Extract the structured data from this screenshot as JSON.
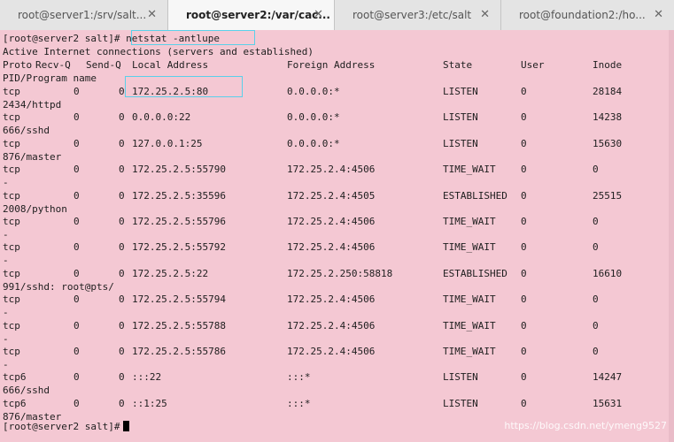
{
  "tabs": [
    {
      "label": "root@server1:/srv/salt..."
    },
    {
      "label": "root@server2:/var/cac..."
    },
    {
      "label": "root@server3:/etc/salt"
    },
    {
      "label": "root@foundation2:/ho..."
    }
  ],
  "close_glyph": "✕",
  "terminal": {
    "prompt": "[root@server2 salt]# ",
    "command": "netstat -antlupe",
    "header1": "Active Internet connections (servers and established)",
    "columns": [
      "Proto",
      "Recv-Q",
      "Send-Q",
      "Local Address",
      "Foreign Address",
      "State",
      "User",
      "Inode"
    ],
    "pid_header": "PID/Program name",
    "rows": [
      {
        "proto": "tcp",
        "recvq": "0",
        "sendq": "0",
        "local": "172.25.2.5:80",
        "foreign": "0.0.0.0:*",
        "state": "LISTEN",
        "user": "0",
        "inode": "28184",
        "pid": "2434/httpd"
      },
      {
        "proto": "tcp",
        "recvq": "0",
        "sendq": "0",
        "local": "0.0.0.0:22",
        "foreign": "0.0.0.0:*",
        "state": "LISTEN",
        "user": "0",
        "inode": "14238",
        "pid": "666/sshd"
      },
      {
        "proto": "tcp",
        "recvq": "0",
        "sendq": "0",
        "local": "127.0.0.1:25",
        "foreign": "0.0.0.0:*",
        "state": "LISTEN",
        "user": "0",
        "inode": "15630",
        "pid": "876/master"
      },
      {
        "proto": "tcp",
        "recvq": "0",
        "sendq": "0",
        "local": "172.25.2.5:55790",
        "foreign": "172.25.2.4:4506",
        "state": "TIME_WAIT",
        "user": "0",
        "inode": "0",
        "pid": "-"
      },
      {
        "proto": "tcp",
        "recvq": "0",
        "sendq": "0",
        "local": "172.25.2.5:35596",
        "foreign": "172.25.2.4:4505",
        "state": "ESTABLISHED",
        "user": "0",
        "inode": "25515",
        "pid": "2008/python"
      },
      {
        "proto": "tcp",
        "recvq": "0",
        "sendq": "0",
        "local": "172.25.2.5:55796",
        "foreign": "172.25.2.4:4506",
        "state": "TIME_WAIT",
        "user": "0",
        "inode": "0",
        "pid": "-"
      },
      {
        "proto": "tcp",
        "recvq": "0",
        "sendq": "0",
        "local": "172.25.2.5:55792",
        "foreign": "172.25.2.4:4506",
        "state": "TIME_WAIT",
        "user": "0",
        "inode": "0",
        "pid": "-"
      },
      {
        "proto": "tcp",
        "recvq": "0",
        "sendq": "0",
        "local": "172.25.2.5:22",
        "foreign": "172.25.2.250:58818",
        "state": "ESTABLISHED",
        "user": "0",
        "inode": "16610",
        "pid": "991/sshd: root@pts/"
      },
      {
        "proto": "tcp",
        "recvq": "0",
        "sendq": "0",
        "local": "172.25.2.5:55794",
        "foreign": "172.25.2.4:4506",
        "state": "TIME_WAIT",
        "user": "0",
        "inode": "0",
        "pid": "-"
      },
      {
        "proto": "tcp",
        "recvq": "0",
        "sendq": "0",
        "local": "172.25.2.5:55788",
        "foreign": "172.25.2.4:4506",
        "state": "TIME_WAIT",
        "user": "0",
        "inode": "0",
        "pid": "-"
      },
      {
        "proto": "tcp",
        "recvq": "0",
        "sendq": "0",
        "local": "172.25.2.5:55786",
        "foreign": "172.25.2.4:4506",
        "state": "TIME_WAIT",
        "user": "0",
        "inode": "0",
        "pid": "-"
      },
      {
        "proto": "tcp6",
        "recvq": "0",
        "sendq": "0",
        "local": ":::22",
        "foreign": ":::*",
        "state": "LISTEN",
        "user": "0",
        "inode": "14247",
        "pid": "666/sshd"
      },
      {
        "proto": "tcp6",
        "recvq": "0",
        "sendq": "0",
        "local": "::1:25",
        "foreign": ":::*",
        "state": "LISTEN",
        "user": "0",
        "inode": "15631",
        "pid": "876/master"
      }
    ],
    "final_prompt": "[root@server2 salt]#"
  },
  "watermark": "https://blog.csdn.net/ymeng9527",
  "colors": {
    "terminal_bg": "#f4c8d3",
    "highlight": "#5ad0ea"
  }
}
